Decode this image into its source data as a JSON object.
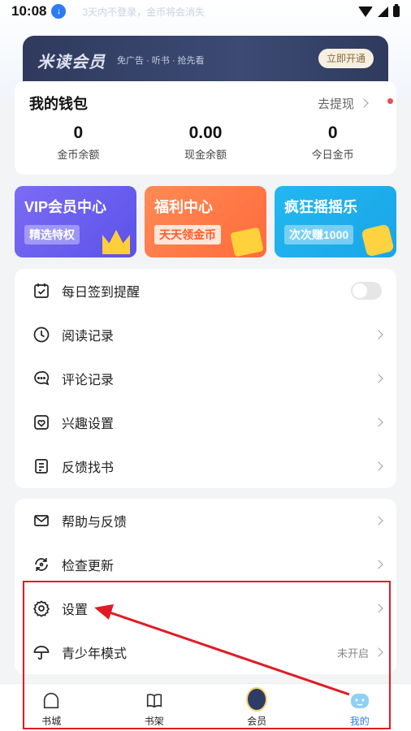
{
  "status_bar": {
    "time": "10:08",
    "hint": "3天内不登录，金币将会消失"
  },
  "vip_banner": {
    "title": "米读会员",
    "subtitle": "免广告 · 听书 · 抢先看",
    "button": "立即开通"
  },
  "wallet": {
    "title": "我的钱包",
    "withdraw_link": "去提现",
    "stats": [
      {
        "value": "0",
        "label": "金币余额"
      },
      {
        "value": "0.00",
        "label": "现金余额"
      },
      {
        "value": "0",
        "label": "今日金币"
      }
    ]
  },
  "promos": [
    {
      "title": "VIP会员中心",
      "tag": "精选特权"
    },
    {
      "title": "福利中心",
      "tag": "天天领金币"
    },
    {
      "title": "疯狂摇摇乐",
      "tag": "次次赚1000"
    }
  ],
  "menu_group_1": [
    {
      "label": "每日签到提醒",
      "icon": "calendar-check-icon"
    },
    {
      "label": "阅读记录",
      "icon": "clock-icon"
    },
    {
      "label": "评论记录",
      "icon": "comment-icon"
    },
    {
      "label": "兴趣设置",
      "icon": "heart-shield-icon"
    },
    {
      "label": "反馈找书",
      "icon": "document-icon"
    }
  ],
  "menu_group_2": [
    {
      "label": "帮助与反馈",
      "icon": "mail-icon"
    },
    {
      "label": "检查更新",
      "icon": "refresh-icon"
    },
    {
      "label": "设置",
      "icon": "gear-icon"
    },
    {
      "label": "青少年模式",
      "icon": "umbrella-icon",
      "status": "未开启"
    }
  ],
  "tabbar": [
    {
      "label": "书城",
      "icon": "home-icon"
    },
    {
      "label": "书架",
      "icon": "book-icon"
    },
    {
      "label": "会员",
      "icon": "member-icon"
    },
    {
      "label": "我的",
      "icon": "profile-icon",
      "active": true
    }
  ],
  "colors": {
    "accent": "#2d7bf3",
    "annotation": "#e01b24"
  }
}
